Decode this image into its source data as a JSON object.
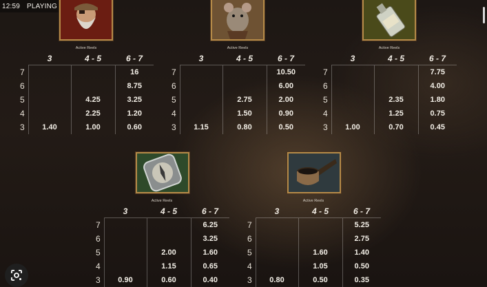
{
  "status": {
    "time": "12:59",
    "mode": "PLAYING FOR FUN"
  },
  "active_reels_label": "Active Reels",
  "headers": [
    "3",
    "4 - 5",
    "6 - 7"
  ],
  "symbols": [
    {
      "icon": "dwarf-icon",
      "rows": [
        {
          "count": "7",
          "v3": "",
          "v45": "",
          "v67": "16"
        },
        {
          "count": "6",
          "v3": "",
          "v45": "",
          "v67": "8.75"
        },
        {
          "count": "5",
          "v3": "",
          "v45": "4.25",
          "v67": "3.25"
        },
        {
          "count": "4",
          "v3": "",
          "v45": "2.25",
          "v67": "1.20"
        },
        {
          "count": "3",
          "v3": "1.40",
          "v45": "1.00",
          "v67": "0.60"
        }
      ]
    },
    {
      "icon": "rat-icon",
      "rows": [
        {
          "count": "7",
          "v3": "",
          "v45": "",
          "v67": "10.50"
        },
        {
          "count": "6",
          "v3": "",
          "v45": "",
          "v67": "6.00"
        },
        {
          "count": "5",
          "v3": "",
          "v45": "2.75",
          "v67": "2.00"
        },
        {
          "count": "4",
          "v3": "",
          "v45": "1.50",
          "v67": "0.90"
        },
        {
          "count": "3",
          "v3": "1.15",
          "v45": "0.80",
          "v67": "0.50"
        }
      ]
    },
    {
      "icon": "bottle-icon",
      "rows": [
        {
          "count": "7",
          "v3": "",
          "v45": "",
          "v67": "7.75"
        },
        {
          "count": "6",
          "v3": "",
          "v45": "",
          "v67": "4.00"
        },
        {
          "count": "5",
          "v3": "",
          "v45": "2.35",
          "v67": "1.80"
        },
        {
          "count": "4",
          "v3": "",
          "v45": "1.25",
          "v67": "0.75"
        },
        {
          "count": "3",
          "v3": "1.00",
          "v45": "0.70",
          "v67": "0.45"
        }
      ]
    },
    {
      "icon": "compass-icon",
      "rows": [
        {
          "count": "7",
          "v3": "",
          "v45": "",
          "v67": "6.25"
        },
        {
          "count": "6",
          "v3": "",
          "v45": "",
          "v67": "3.25"
        },
        {
          "count": "5",
          "v3": "",
          "v45": "2.00",
          "v67": "1.60"
        },
        {
          "count": "4",
          "v3": "",
          "v45": "1.15",
          "v67": "0.65"
        },
        {
          "count": "3",
          "v3": "0.90",
          "v45": "0.60",
          "v67": "0.40"
        }
      ]
    },
    {
      "icon": "pipe-icon",
      "rows": [
        {
          "count": "7",
          "v3": "",
          "v45": "",
          "v67": "5.25"
        },
        {
          "count": "6",
          "v3": "",
          "v45": "",
          "v67": "2.75"
        },
        {
          "count": "5",
          "v3": "",
          "v45": "1.60",
          "v67": "1.40"
        },
        {
          "count": "4",
          "v3": "",
          "v45": "1.05",
          "v67": "0.50"
        },
        {
          "count": "3",
          "v3": "0.80",
          "v45": "0.50",
          "v67": "0.35"
        }
      ]
    }
  ]
}
